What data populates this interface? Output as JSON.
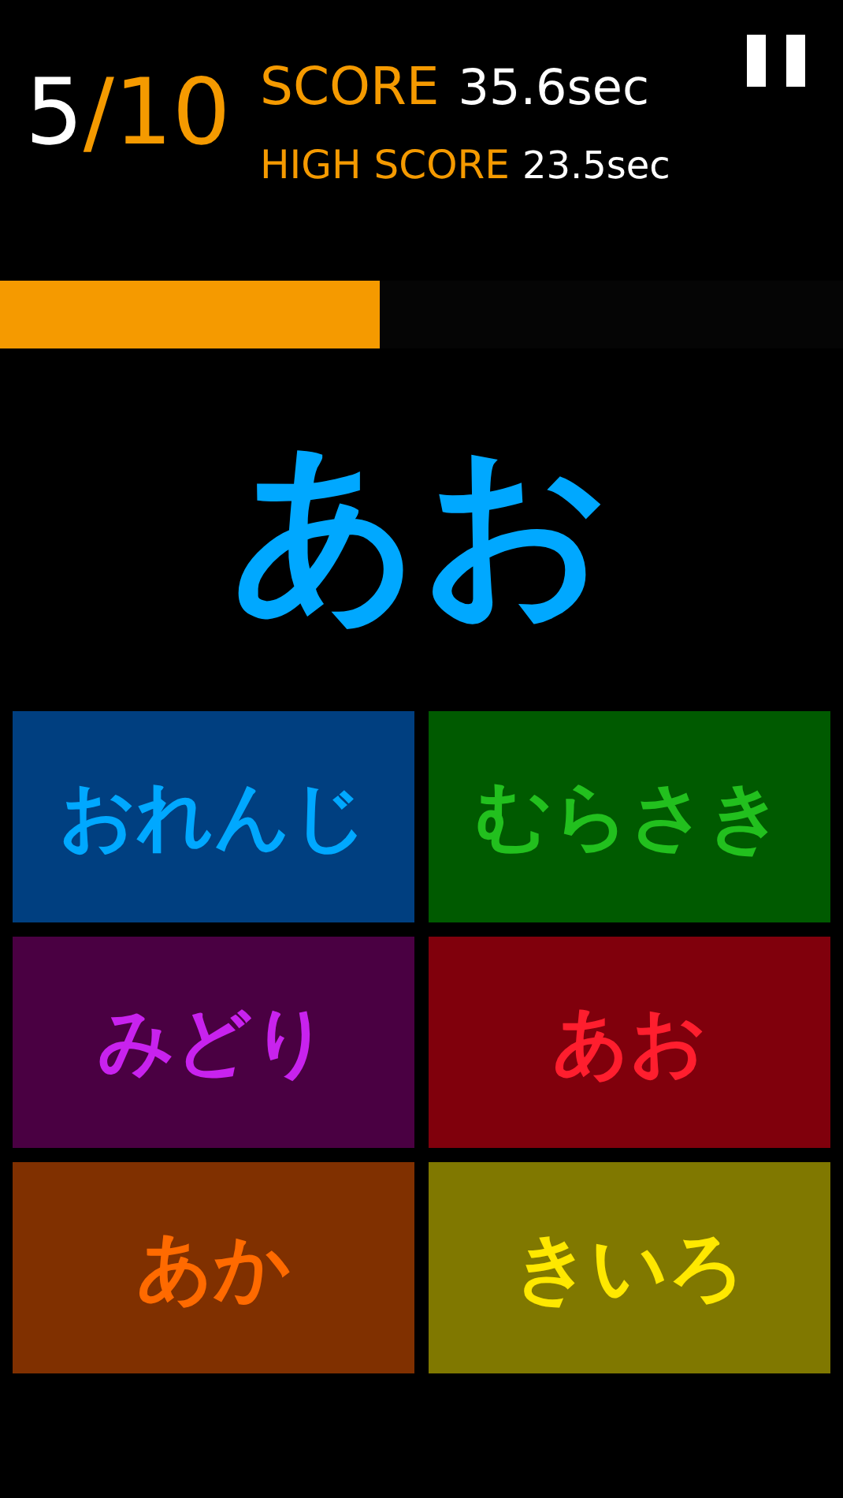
{
  "counter": {
    "current": "5",
    "rest": "/10"
  },
  "score": {
    "label": "SCORE",
    "value": "35.6sec"
  },
  "high_score": {
    "label": "HIGH SCORE",
    "value": "23.5sec"
  },
  "timer": {
    "level": 0.45
  },
  "question": {
    "word": "あお",
    "color": "#00a8ff"
  },
  "answers": [
    {
      "label": "おれんじ",
      "color": "#00a8ff",
      "tile": {
        "color": "#003f80"
      }
    },
    {
      "label": "むらさき",
      "color": "#22c01e",
      "tile": {
        "color": "#005a00"
      }
    },
    {
      "label": "みどり",
      "color": "#c822ee",
      "tile": {
        "color": "#4a0042"
      }
    },
    {
      "label": "あお",
      "color": "#ff1e2e",
      "tile": {
        "color": "#80000c"
      }
    },
    {
      "label": "あか",
      "color": "#ff6a00",
      "tile": {
        "color": "#803000"
      }
    },
    {
      "label": "きいろ",
      "color": "#ffe800",
      "tile": {
        "color": "#807800"
      }
    }
  ]
}
